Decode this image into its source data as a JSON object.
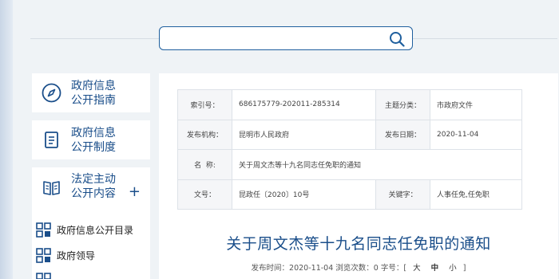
{
  "search": {
    "placeholder": ""
  },
  "sidebar": {
    "cards": [
      {
        "line1": "政府信息",
        "line2": "公开指南",
        "icon": "compass-icon"
      },
      {
        "line1": "政府信息",
        "line2": "公开制度",
        "icon": "document-icon"
      },
      {
        "line1": "法定主动",
        "line2": "公开内容",
        "icon": "book-icon",
        "expand": "+"
      }
    ],
    "items": [
      {
        "label": "政府信息公开目录",
        "icon": "grid-icon"
      },
      {
        "label": "政府领导",
        "icon": "grid-icon"
      }
    ]
  },
  "info": {
    "index_label": "索引号：",
    "index_value": "686175779-202011-285314",
    "topic_label": "主题分类：",
    "topic_value": "市政府文件",
    "issuer_label": "发布机构：",
    "issuer_value": "昆明市人民政府",
    "date_label": "发布日期：",
    "date_value": "2020-11-04",
    "name_label": "名  称:",
    "name_value": "关于周文杰等十九名同志任免职的通知",
    "docno_label": "文号：",
    "docno_value": "昆政任〔2020〕10号",
    "keywords_label": "关键字：",
    "keywords_value": "人事任免,任免职"
  },
  "article": {
    "title": "关于周文杰等十九名同志任免职的通知",
    "publish_prefix": "发布时间：2020-11-04 浏览次数：0 字号：[",
    "size_large": "大",
    "size_medium": "中",
    "size_small": "小",
    "publish_suffix": "]"
  },
  "colors": {
    "accent": "#1a4e8a",
    "border": "#1f5f9e",
    "background": "#eff3f6"
  }
}
